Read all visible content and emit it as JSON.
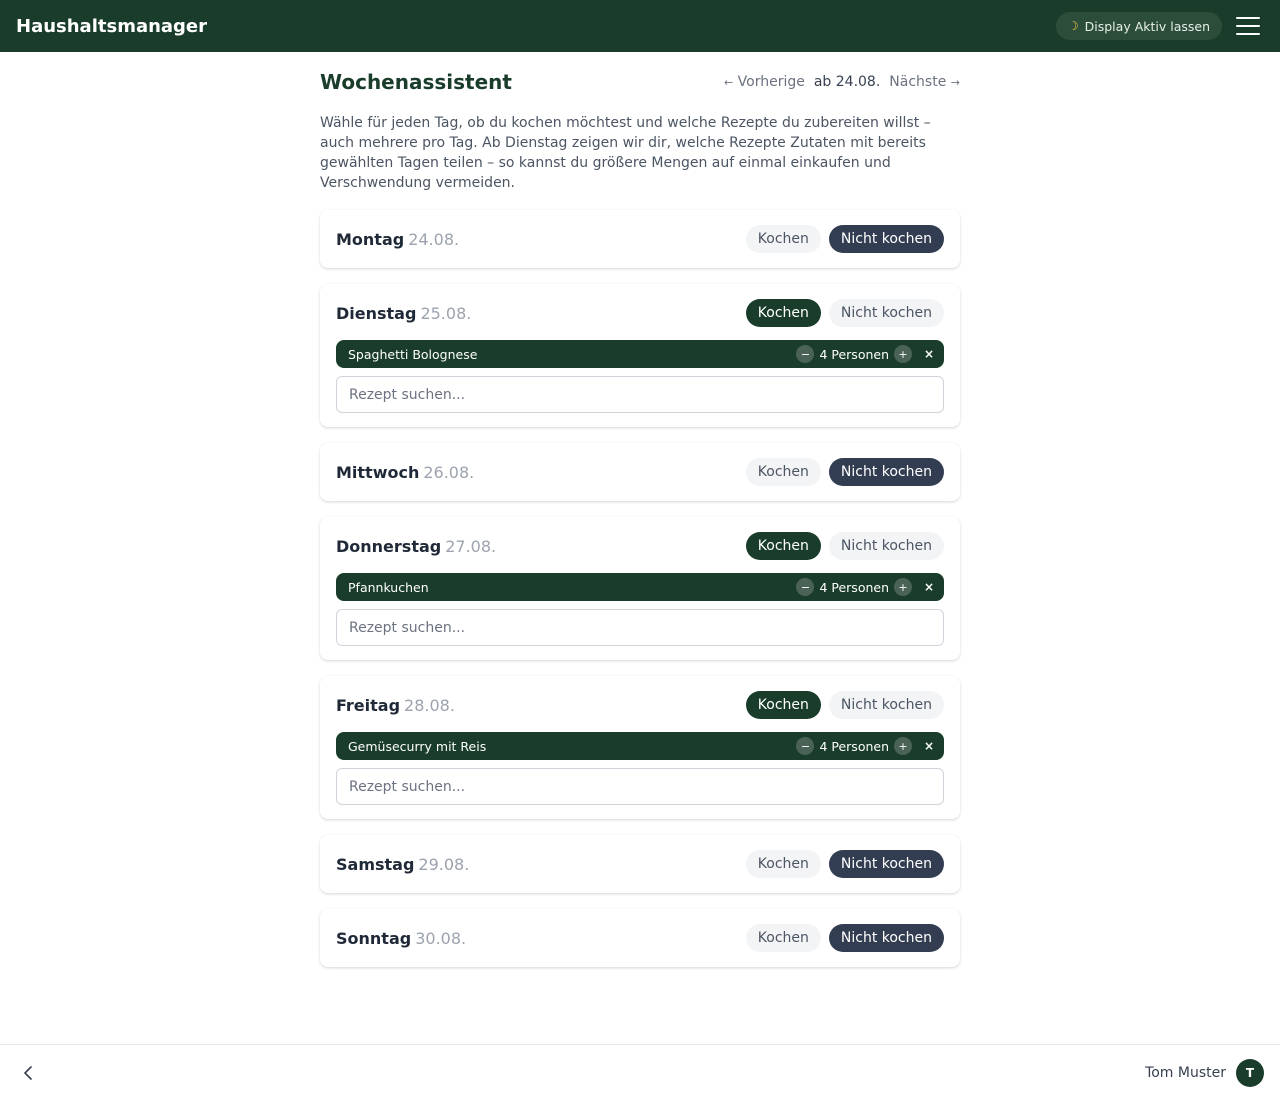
{
  "header": {
    "app_title": "Haushaltsmanager",
    "display_button": "Display Aktiv lassen",
    "moon_icon": "moon-icon",
    "menu_icon": "hamburger-menu-icon"
  },
  "page": {
    "title": "Wochenassistent",
    "nav": {
      "prev": "Vorherige",
      "week": "ab 24.08.",
      "next": "Nächste"
    },
    "intro": "Wähle für jeden Tag, ob du kochen möchtest und welche Rezepte du zubereiten willst – auch mehrere pro Tag. Ab Dienstag zeigen wir dir, welche Rezepte Zutaten mit bereits gewählten Tagen teilen – so kannst du größere Mengen auf einmal einkaufen und Verschwendung vermeiden."
  },
  "labels": {
    "cook": "Kochen",
    "no_cook": "Nicht kochen",
    "search_placeholder": "Rezept suchen..."
  },
  "days": [
    {
      "name": "Montag",
      "date": "24.08.",
      "cooking": false
    },
    {
      "name": "Dienstag",
      "date": "25.08.",
      "cooking": true,
      "recipe": "Spaghetti Bolognese",
      "persons": "4 Personen"
    },
    {
      "name": "Mittwoch",
      "date": "26.08.",
      "cooking": false
    },
    {
      "name": "Donnerstag",
      "date": "27.08.",
      "cooking": true,
      "recipe": "Pfannkuchen",
      "persons": "4 Personen"
    },
    {
      "name": "Freitag",
      "date": "28.08.",
      "cooking": true,
      "recipe": "Gemüsecurry mit Reis",
      "persons": "4 Personen"
    },
    {
      "name": "Samstag",
      "date": "29.08.",
      "cooking": false
    },
    {
      "name": "Sonntag",
      "date": "30.08.",
      "cooking": false
    }
  ],
  "footer": {
    "back_icon": "chevron-left-icon",
    "user_name": "Tom Muster",
    "avatar_initial": "T"
  },
  "colors": {
    "brand": "#1a3d2b",
    "inactive_dark": "#333d52",
    "button_light": "#f3f4f6"
  }
}
